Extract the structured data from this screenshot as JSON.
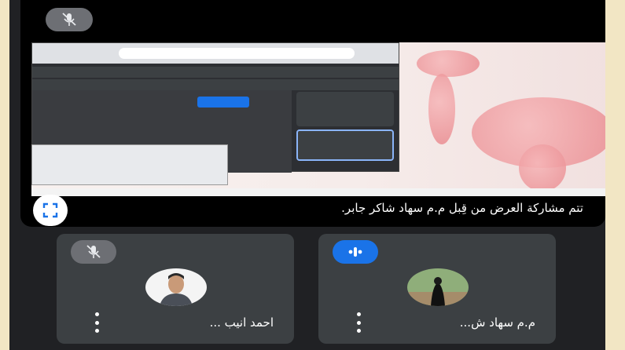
{
  "presentation": {
    "banner_text": "تتم مشاركة العرض من قِبل م.م سهاد شاكر جابر.",
    "expand_icon": "fullscreen-icon"
  },
  "participants": [
    {
      "name": "احمد انيب ...",
      "status": "muted",
      "status_icon": "mic-off-icon",
      "pill_color": "#6d6f74"
    },
    {
      "name": "م.م سهاد ش...",
      "status": "speaking",
      "status_icon": "audio-level-icon",
      "pill_color": "#1a73e8"
    }
  ],
  "top_tile": {
    "status_icon": "mic-off-icon"
  },
  "colors": {
    "background": "#202124",
    "tile": "#3c4043",
    "accent": "#1a73e8",
    "frame": "#f2e6c4"
  }
}
